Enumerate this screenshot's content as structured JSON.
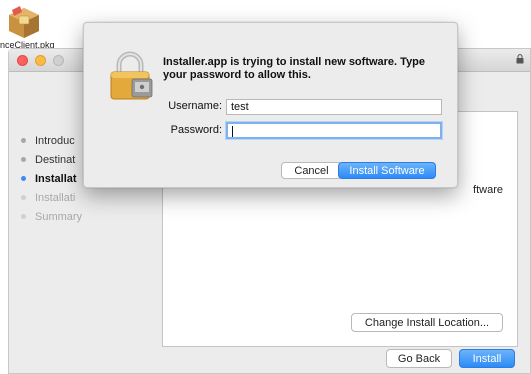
{
  "desktop": {
    "package_label": "nceClient.pkg",
    "package_icon": "package-icon"
  },
  "installer": {
    "steps": [
      {
        "label": "Introduc",
        "state": "done"
      },
      {
        "label": "Destinat",
        "state": "done"
      },
      {
        "label": "Installat",
        "state": "current"
      },
      {
        "label": "Installati",
        "state": "pending"
      },
      {
        "label": "Summary",
        "state": "pending"
      }
    ],
    "content_text": "ftware",
    "change_location_label": "Change Install Location...",
    "go_back_label": "Go Back",
    "install_label": "Install"
  },
  "dialog": {
    "message": "Installer.app is trying to install new software. Type your password to allow this.",
    "username_label": "Username:",
    "username_value": "test",
    "password_label": "Password:",
    "password_value": "",
    "cancel_label": "Cancel",
    "install_software_label": "Install Software",
    "icon": "lock-icon"
  },
  "colors": {
    "accent": "#2d8bf6",
    "close": "#fc615d",
    "minimize": "#fdbc40",
    "current_step": "#3f8bf3"
  }
}
